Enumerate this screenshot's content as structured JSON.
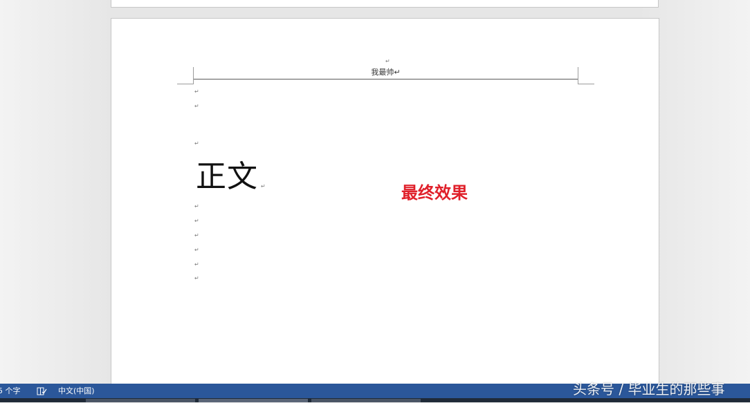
{
  "document": {
    "header_text": "我最帅↵",
    "body_title": "正文",
    "paragraph_mark": "↵"
  },
  "annotation": {
    "text": "最终效果",
    "color": "#e0202a"
  },
  "statusbar": {
    "word_count": "5 个字",
    "proofing_icon": "proofing-book-icon",
    "language": "中文(中国)",
    "background_color": "#2b579a"
  },
  "watermark": {
    "text": "头条号 / 毕业生的那些事"
  }
}
